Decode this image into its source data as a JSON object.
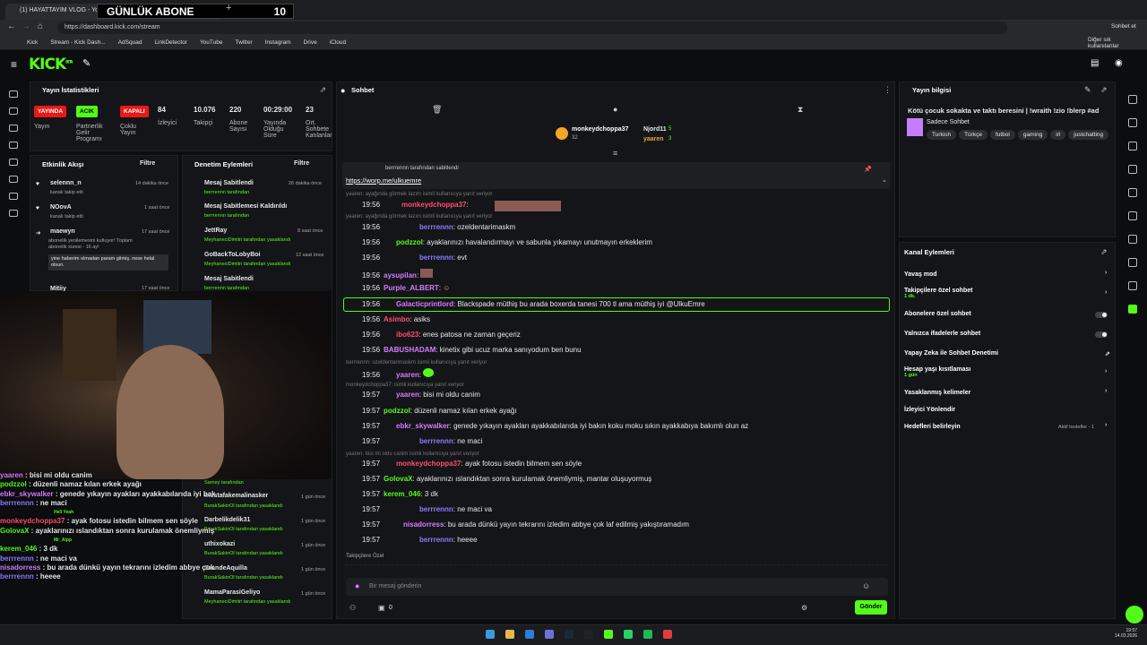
{
  "browser": {
    "tab_title": "(1) HAYATTAYIM VLOG - YouTube",
    "url": "https://dashboard.kick.com/stream",
    "profile_label": "Sohbet et"
  },
  "overlay": {
    "label": "GÜNLÜK ABONE",
    "count": "10"
  },
  "bookmarks": [
    "Kick",
    "Stream - Kick Dash...",
    "AdSquad",
    "LinkDetector",
    "YouTube",
    "Twitter",
    "Instagram",
    "Drive",
    "iCloud"
  ],
  "bookmarks_other": "Diğer sık kullanılanlar",
  "logo": "KICK",
  "logo_beta": "BETA",
  "stats": {
    "title": "Yayın İstatistikleri",
    "items": [
      {
        "badge": "YAYINDA",
        "label": "Yayın",
        "color": "#e91916"
      },
      {
        "badge": "ACIK",
        "label": "Partnerlik Gelir Programı",
        "color": "#53fc18"
      },
      {
        "badge": "KAPALI",
        "label": "Çoklu Yayın",
        "color": "#e91916"
      },
      {
        "value": "84",
        "label": "İzleyici"
      },
      {
        "value": "10.076",
        "label": "Takipçi"
      },
      {
        "value": "220",
        "label": "Abone Sayısı"
      },
      {
        "value": "00:29:00",
        "label": "Yayında Olduğu Süre"
      },
      {
        "value": "23",
        "label": "Ort. Sohbete Katılanlar"
      }
    ]
  },
  "activity": {
    "title": "Etkinlik Akışı",
    "filter": "Filtre",
    "items": [
      {
        "name": "selennn_n",
        "desc": "kanalı takip etti",
        "time": "14 dakika önce"
      },
      {
        "name": "NOovA",
        "desc": "kanalı takip etti",
        "time": "1 saat önce"
      },
      {
        "name": "maewyn",
        "desc": "abonelik yenilemesini kutluyor! Toplam abonelik süresi - 16 ay!",
        "quote": "yine haberim olmadan param gitmiş. nese helal olsun.",
        "time": "17 saat önce"
      },
      {
        "name": "Mitiiy",
        "desc": "",
        "time": "17 saat önce"
      }
    ]
  },
  "moderation": {
    "title": "Denetim Eylemleri",
    "filter": "Filtre",
    "items": [
      {
        "action": "Mesaj Sabitlendi",
        "by": "berrrennn tarafından",
        "time": "26 dakika önce"
      },
      {
        "action": "Mesaj Sabitlemesi Kaldırıldı",
        "by": "berrrennn tarafından",
        "time": "26 dakika önce"
      },
      {
        "action": "JettRay",
        "by": "MeyhaneciDimitri tarafından yasaklandı",
        "time": "8 saat önce"
      },
      {
        "action": "GoBackToLobyBoi",
        "by": "MeyhaneciDimitri tarafından yasaklandı",
        "time": "12 saat önce"
      },
      {
        "action": "Mesaj Sabitlendi",
        "by": "berrrennn tarafından",
        "time": "17 saat önce"
      },
      {
        "action": "Sarney tarafından",
        "by": "",
        "time": ""
      },
      {
        "action": "mustafakemalinasker",
        "by": "BurakSakinOl tarafından yasaklandı",
        "time": "1 gün önce"
      },
      {
        "action": "Darbelikdelik31",
        "by": "BurakSakinOl tarafından yasaklandı",
        "time": "1 gün önce"
      },
      {
        "action": "uthixokazi",
        "by": "BurakSakinOl tarafından yasaklandı",
        "time": "1 gün önce"
      },
      {
        "action": "GrandeAquilla",
        "by": "BurakSakinOl tarafından yasaklandı",
        "time": "1 gün önce"
      },
      {
        "action": "MamaParasiGeliyo",
        "by": "MeyhaneciDimitri tarafından yasaklandı",
        "time": "1 gün önce"
      }
    ]
  },
  "chat": {
    "title": "Sohbet",
    "top": [
      {
        "name": "monkeydchoppa37",
        "count": "32"
      },
      {
        "name": "Njord11",
        "count": "5"
      },
      {
        "name": "yaaren",
        "count": "3"
      }
    ],
    "pinned_by": "berrrennn tarafından sabitlendi",
    "pinned_link": "https://worp.me/ulkuemre",
    "messages": [
      {
        "reply": "yaaren: ayağında görmek lazım  isimli kullanıcıya yanıt veriyor",
        "time": "19:56",
        "user": "monkeydchoppa37",
        "color": "#ff4d6d",
        "text": ""
      },
      {
        "reply": "yaaren: ayağında görmek lazım  isimli kullanıcıya yanıt veriyor",
        "time": "19:56",
        "user": "berrrennn",
        "color": "#8a7dff",
        "text": "ozeldentarimaskm"
      },
      {
        "time": "19:56",
        "user": "podzzol",
        "color": "#53fc18",
        "text": "ayaklarınızı havalandırmayı ve sabunla yıkamayı unutmayın erkeklerim"
      },
      {
        "time": "19:56",
        "user": "berrrennn",
        "color": "#8a7dff",
        "text": "evt"
      },
      {
        "time": "19:56",
        "user": "aysupilan",
        "color": "#d57cff",
        "text": ""
      },
      {
        "time": "19:56",
        "user": "Purple_ALBERT",
        "color": "#d57cff",
        "text": ""
      },
      {
        "time": "19:56",
        "user": "Galacticprintlord",
        "color": "#d57cff",
        "text": "Blackspade müthiş bu arada boxerda tanesi 700 tl ama müthiş iyi @UlkuEmre",
        "highlight": true
      },
      {
        "time": "19:56",
        "user": "Asimbo",
        "color": "#ff4d6d",
        "text": "asiks"
      },
      {
        "time": "19:56",
        "user": "ibo623",
        "color": "#ff4d6d",
        "text": "enes patosa ne zaman geçeriz"
      },
      {
        "time": "19:56",
        "user": "BABUSHADAM",
        "color": "#d57cff",
        "text": "kinetix gibi ucuz marka sanıyodum ben bunu"
      },
      {
        "reply": "berrrennn: ozeldentarimaskm isimli kullanıcıya yanıt veriyor",
        "time": "19:56",
        "user": "yaaren",
        "color": "#d57cff",
        "text": ""
      },
      {
        "reply": "monkeydchoppa37:  isimli kullanıcıya yanıt veriyor",
        "time": "19:57",
        "user": "yaaren",
        "color": "#d57cff",
        "text": "bisi mi oldu canim"
      },
      {
        "time": "19:57",
        "user": "podzzol",
        "color": "#53fc18",
        "text": "düzenli namaz kılan erkek ayağı"
      },
      {
        "time": "19:57",
        "user": "ebkr_skywalker",
        "color": "#d57cff",
        "text": "genede yıkayın ayakları ayakkabılarıda iyi bakın koku moku sıkın ayakkabıya bakımlı olun az"
      },
      {
        "time": "19:57",
        "user": "berrrennn",
        "color": "#8a7dff",
        "text": "ne maci"
      },
      {
        "reply": "yaaren: bisi mi oldu canim isimli kullanıcıya yanıt veriyor",
        "time": "19:57",
        "user": "monkeydchoppa37",
        "color": "#ff4d6d",
        "text": "ayak fotosu istedin bilmem sen söyle"
      },
      {
        "time": "19:57",
        "user": "GolovaX",
        "color": "#53fc18",
        "text": "ayaklarınızı ıslandıktan sonra kurulamak önemliymiş, mantar oluşuyormuş"
      },
      {
        "time": "19:57",
        "user": "kerem_046",
        "color": "#53fc18",
        "text": "3 dk"
      },
      {
        "time": "19:57",
        "user": "berrrennn",
        "color": "#8a7dff",
        "text": "ne maci va"
      },
      {
        "time": "19:57",
        "user": "nisadorress",
        "color": "#d57cff",
        "text": "bu arada dünkü yayın tekrarını izledim abbye çok laf edilmiş yakıştıramadım"
      },
      {
        "time": "19:57",
        "user": "berrrennn",
        "color": "#8a7dff",
        "text": "heeee"
      }
    ],
    "subs_label": "Takipçilere Özel",
    "input_placeholder": "Bir mesaj gönderin",
    "send": "Gönder",
    "viewer_icons_count": "0"
  },
  "info": {
    "title": "Yayın bilgisi",
    "stream_title": "Kötü çocuk sokakta ve taktı beresini  | !wraith !zio !blerp #ad",
    "category": "Sadece Sohbet",
    "tags": [
      "Turkish",
      "Türkçe",
      "futbol",
      "gaming",
      "irl",
      "justchatting"
    ]
  },
  "actions": {
    "title": "Kanal Eylemleri",
    "items": [
      {
        "label": "Yavaş mod",
        "type": "arrow"
      },
      {
        "label": "Takipçilere özel sohbet",
        "sub": "1 dk.",
        "type": "arrow"
      },
      {
        "label": "Abonelere özel sohbet",
        "type": "toggle"
      },
      {
        "label": "Yalnızca ifadelerle sohbet",
        "type": "toggle"
      },
      {
        "label": "Yapay Zeka ile Sohbet Denetimi",
        "type": "link"
      },
      {
        "label": "Hesap yaşı kısıtlaması",
        "sub": "1 gün",
        "type": "arrow"
      },
      {
        "label": "Yasaklanmış kelimeler",
        "type": "arrow"
      },
      {
        "label": "İzleyici Yönlendir",
        "type": "none"
      },
      {
        "label": "Hedefleri belirleyin",
        "side": "Aktif hedefler - 1",
        "type": "arrow"
      }
    ]
  },
  "overlay_chat": [
    {
      "user": "yaaren",
      "color": "#d57cff",
      "text": "bisi mi oldu canim"
    },
    {
      "user": "podzzol",
      "color": "#53fc18",
      "text": "düzenli namaz kılan erkek ayağı"
    },
    {
      "user": "ebkr_skywalker",
      "color": "#d57cff",
      "text": "genede yıkayın ayakları ayakkabılarıda iyi bakın koku moku sıkın ayakkabıya bakımlı olun az"
    },
    {
      "user": "berrrennn",
      "color": "#8a7dff",
      "text": "ne maci"
    },
    {
      "user": "monkeydchoppa37",
      "color": "#ff4d6d",
      "text": "ayak fotosu istedin bilmem sen söyle"
    },
    {
      "user": "GolovaX",
      "color": "#53fc18",
      "text": "ayaklarınızı ıslandıktan sonra kurulamak önemliymiş, mantar oluşuyormuş"
    },
    {
      "user": "kerem_046",
      "color": "#53fc18",
      "text": "3 dk"
    },
    {
      "user": "berrrennn",
      "color": "#8a7dff",
      "text": "ne maci va"
    },
    {
      "user": "nisadorress",
      "color": "#d57cff",
      "text": "bu arada dünkü yayın tekrarını izledim abbye çok laf edilmiş yakıştıramadım"
    },
    {
      "user": "berrrennn",
      "color": "#8a7dff",
      "text": "heeee"
    }
  ],
  "overlay_labels": {
    "hell_yeah": "Hell Yeah",
    "alpp": "Mr_Alpp"
  },
  "taskbar": {
    "time": "19:57",
    "date": "14.03.2026"
  },
  "colors": {
    "kick_green": "#53fc18",
    "live_red": "#e91916",
    "panel": "#141518"
  }
}
